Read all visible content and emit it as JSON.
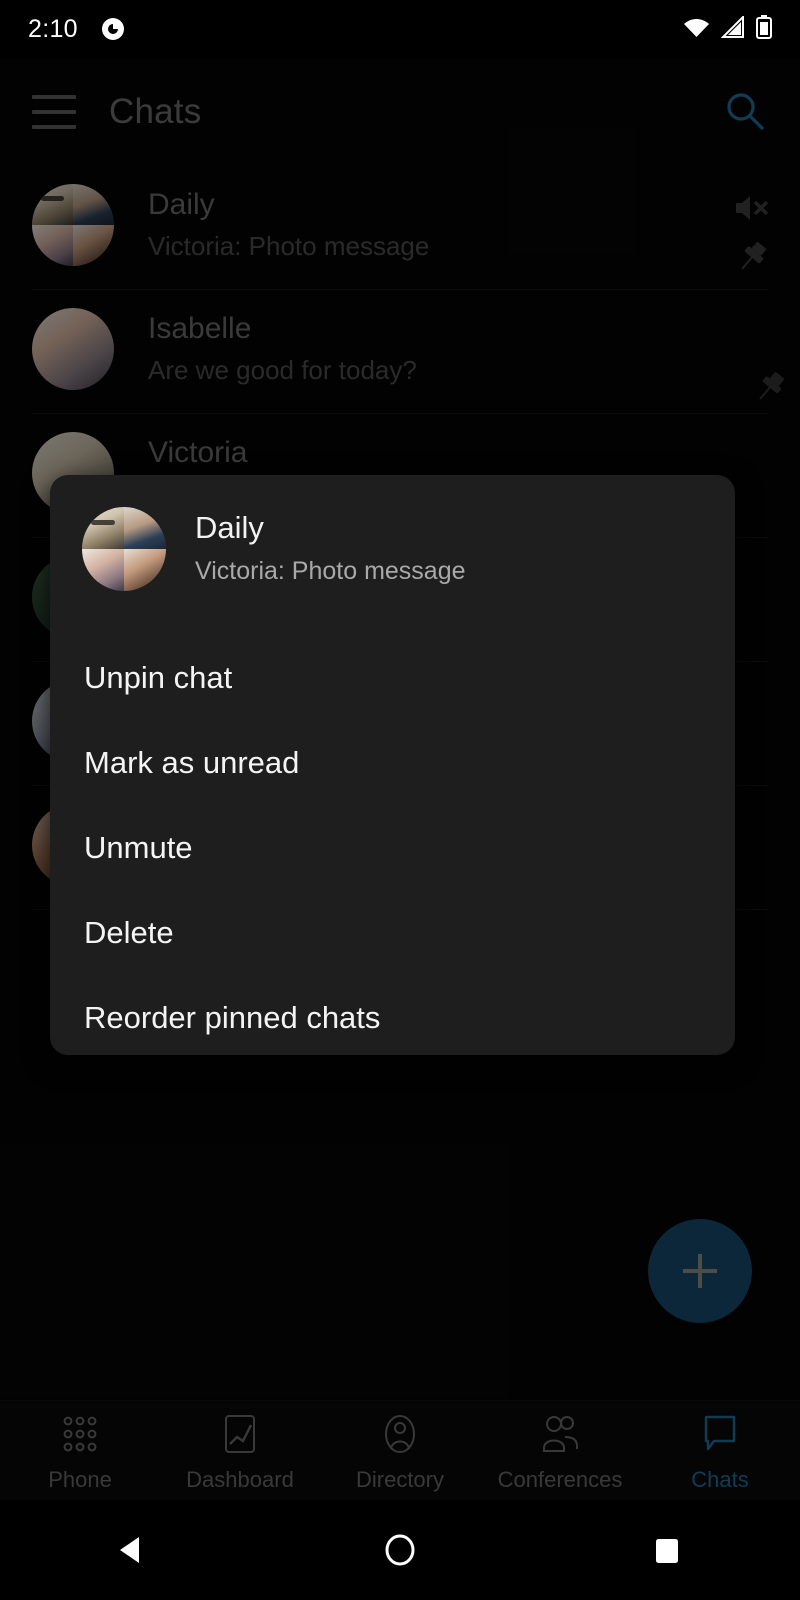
{
  "status_bar": {
    "time": "2:10",
    "app_icon": "g-circle-icon",
    "icons": [
      "wifi-icon",
      "cell-signal-icon",
      "battery-icon"
    ]
  },
  "app_bar": {
    "menu_icon": "hamburger-menu-icon",
    "title": "Chats",
    "search_icon": "search-icon",
    "search_color": "#1f6f9e",
    "title_color": "#6e6e6e"
  },
  "chat_list": [
    {
      "name": "Daily",
      "preview": "Victoria: Photo message",
      "avatar_type": "group-collage",
      "muted": true,
      "pinned": true
    },
    {
      "name": "Isabelle",
      "preview": "Are we good for today?",
      "avatar_type": "single-photo",
      "muted": false,
      "pinned": true
    },
    {
      "name": "Victoria",
      "preview": "",
      "avatar_type": "single-photo",
      "muted": false,
      "pinned": false
    }
  ],
  "dialog": {
    "title": "Daily",
    "subtitle": "Victoria: Photo message",
    "avatar_type": "group-collage",
    "background": "#1e1e1e",
    "items": [
      {
        "label": "Unpin chat"
      },
      {
        "label": "Mark as unread"
      },
      {
        "label": "Unmute"
      },
      {
        "label": "Delete"
      },
      {
        "label": "Reorder pinned chats"
      }
    ]
  },
  "fab": {
    "icon": "plus-icon",
    "color": "#16496a"
  },
  "bottom_nav": {
    "active_color": "#1f6f9e",
    "inactive_color": "#6a6a6a",
    "items": [
      {
        "label": "Phone",
        "icon": "dialpad-icon",
        "active": false
      },
      {
        "label": "Dashboard",
        "icon": "chart-icon",
        "active": false
      },
      {
        "label": "Directory",
        "icon": "contact-icon",
        "active": false
      },
      {
        "label": "Conferences",
        "icon": "group-icon",
        "active": false
      },
      {
        "label": "Chats",
        "icon": "speech-bubble-icon",
        "active": true
      }
    ]
  },
  "android_nav": {
    "back": "back-triangle-icon",
    "home": "home-circle-icon",
    "recents": "recents-square-icon"
  }
}
